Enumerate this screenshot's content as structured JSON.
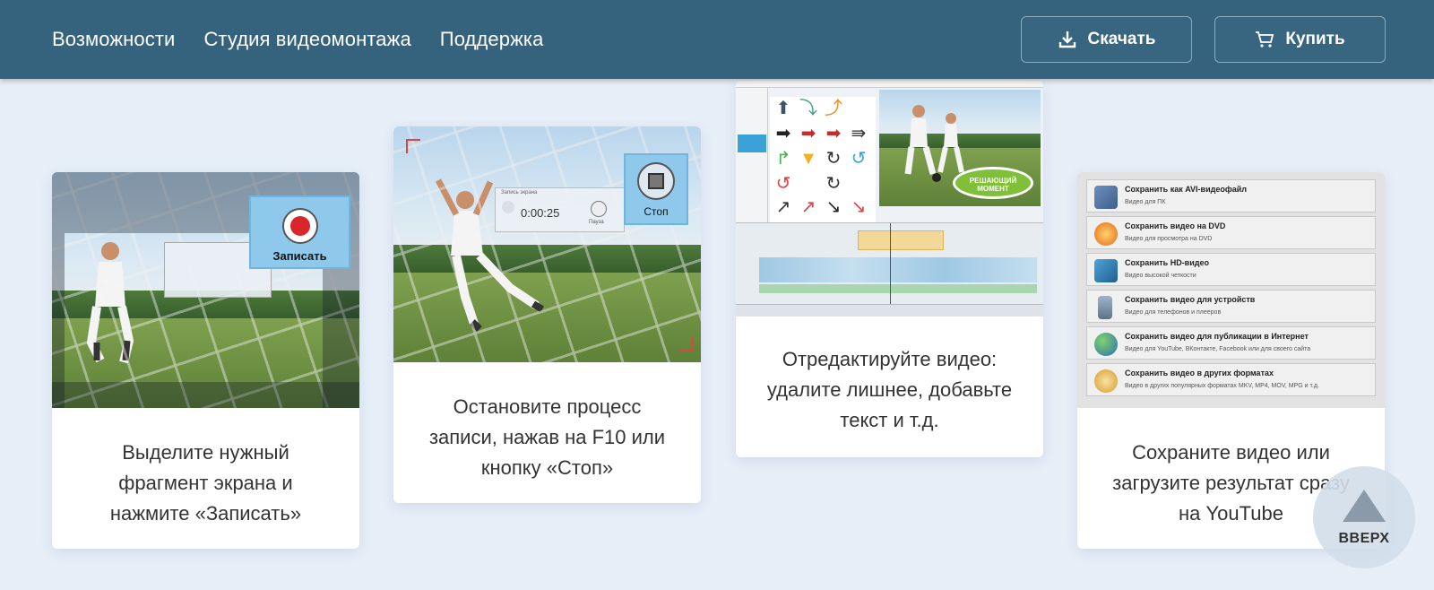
{
  "header": {
    "nav": [
      "Возможности",
      "Студия видеомонтажа",
      "Поддержка"
    ],
    "download_label": "Скачать",
    "buy_label": "Купить"
  },
  "cards": [
    {
      "caption": "Выделите нужный фрагмент экрана и нажмите «Записать»",
      "record_label": "Записать"
    },
    {
      "caption": "Остановите процесс записи, нажав на F10 или кнопку «Стоп»",
      "timer": "0:00:25",
      "timer_title": "Запись экрана",
      "pause_label": "Пауза",
      "stop_label": "Стоп"
    },
    {
      "caption": "Отредактируйте видео: удалите лишнее, добавьте текст и т.д.",
      "bubble_text": "РЕШАЮЩИЙ МОМЕНТ"
    },
    {
      "caption": "Сохраните видео или загрузите результат сразу на YouTube",
      "save_options": [
        {
          "title": "Сохранить как AVI-видеофайл",
          "desc": "Видео для ПК"
        },
        {
          "title": "Сохранить видео на DVD",
          "desc": "Видео для просмотра на DVD"
        },
        {
          "title": "Сохранить HD-видео",
          "desc": "Видео высокой четкости"
        },
        {
          "title": "Сохранить видео для устройств",
          "desc": "Видео для телефонов и плееров"
        },
        {
          "title": "Сохранить видео для публикации в Интернет",
          "desc": "Видео для YouTube, ВКонтакте, Facebook или для своего сайта"
        },
        {
          "title": "Сохранить видео в других форматах",
          "desc": "Видео в других популярных форматах MKV, MP4, MOV, MPG и т.д."
        }
      ]
    }
  ],
  "scroll_top_label": "ВВЕРХ",
  "colors": {
    "header_bg": "#35627d",
    "page_bg": "#e6eef8",
    "accent_blue": "#8ec9ec",
    "record_red": "#d9262a"
  }
}
